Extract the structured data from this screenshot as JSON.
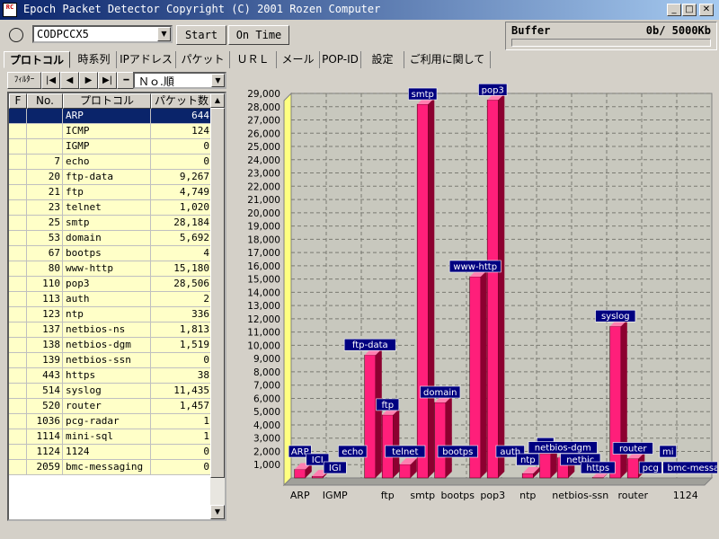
{
  "window": {
    "title": "Epoch Packet Detector   Copyright (C) 2001 Rozen Computer",
    "icon_text": "RC"
  },
  "toolbar": {
    "device": "CODPCCX5",
    "start_label": "Start",
    "ontime_label": "On Time",
    "buffer_label": "Buffer",
    "buffer_value": "0b/ 5000Kb"
  },
  "tabs": [
    "プロトコル",
    "時系列",
    "IPアドレス",
    "パケット",
    "ＵＲＬ",
    "メール",
    "POP-ID",
    "設定",
    "ご利用に関して"
  ],
  "nav": {
    "filter_label": "ﾌｨﾙﾀｰ",
    "sort_value": "Ｎｏ.順"
  },
  "table": {
    "headers": [
      "F",
      "No.",
      "プロトコル",
      "パケット数"
    ],
    "rows": [
      {
        "no": "",
        "protocol": "ARP",
        "count": "644",
        "selected": true
      },
      {
        "no": "",
        "protocol": "ICMP",
        "count": "124"
      },
      {
        "no": "",
        "protocol": "IGMP",
        "count": "0"
      },
      {
        "no": "7",
        "protocol": "echo",
        "count": "0"
      },
      {
        "no": "20",
        "protocol": "ftp-data",
        "count": "9,267"
      },
      {
        "no": "21",
        "protocol": "ftp",
        "count": "4,749"
      },
      {
        "no": "23",
        "protocol": "telnet",
        "count": "1,020"
      },
      {
        "no": "25",
        "protocol": "smtp",
        "count": "28,184"
      },
      {
        "no": "53",
        "protocol": "domain",
        "count": "5,692"
      },
      {
        "no": "67",
        "protocol": "bootps",
        "count": "4"
      },
      {
        "no": "80",
        "protocol": "www-http",
        "count": "15,180"
      },
      {
        "no": "110",
        "protocol": "pop3",
        "count": "28,506"
      },
      {
        "no": "113",
        "protocol": "auth",
        "count": "2"
      },
      {
        "no": "123",
        "protocol": "ntp",
        "count": "336"
      },
      {
        "no": "137",
        "protocol": "netbios-ns",
        "count": "1,813"
      },
      {
        "no": "138",
        "protocol": "netbios-dgm",
        "count": "1,519"
      },
      {
        "no": "139",
        "protocol": "netbios-ssn",
        "count": "0"
      },
      {
        "no": "443",
        "protocol": "https",
        "count": "38"
      },
      {
        "no": "514",
        "protocol": "syslog",
        "count": "11,435"
      },
      {
        "no": "520",
        "protocol": "router",
        "count": "1,457"
      },
      {
        "no": "1036",
        "protocol": "pcg-radar",
        "count": "1"
      },
      {
        "no": "1114",
        "protocol": "mini-sql",
        "count": "1"
      },
      {
        "no": "1124",
        "protocol": "1124",
        "count": "0"
      },
      {
        "no": "2059",
        "protocol": "bmc-messaging",
        "count": "0"
      }
    ]
  },
  "colors": {
    "bar": "#ff1f7a",
    "bar_dark": "#8c0030",
    "label_bg": "#000080",
    "plot_bg": "#c8c8be",
    "wall": "#ffff80",
    "selected_row": "#0a246a"
  },
  "chart_data": {
    "type": "bar",
    "categories": [
      "ARP",
      "ICMP",
      "IGMP",
      "echo",
      "ftp-data",
      "ftp",
      "telnet",
      "smtp",
      "domain",
      "bootps",
      "www-http",
      "pop3",
      "auth",
      "ntp",
      "netbios-ns",
      "netbios-dgm",
      "netbios-ssn",
      "https",
      "syslog",
      "router",
      "pcg-radar",
      "mini-sql",
      "1124",
      "bmc-messaging"
    ],
    "values": [
      644,
      124,
      0,
      0,
      9267,
      4749,
      1020,
      28184,
      5692,
      4,
      15180,
      28506,
      2,
      336,
      1813,
      1519,
      0,
      38,
      11435,
      1457,
      1,
      1,
      0,
      0
    ],
    "bar_labels": [
      "ARP",
      "ICI",
      "IGI",
      "echo",
      "ftp-data",
      "ftp",
      "telnet",
      "smtp",
      "domain",
      "bootps",
      "www-http",
      "pop3",
      "auth",
      "ntp",
      "ne",
      "netbios-dgm",
      "netbic",
      "https",
      "syslog",
      "router",
      "pcg",
      "mi",
      "",
      "bmc-messaging"
    ],
    "axis_labels": [
      "ARP",
      "IGMP",
      "ftp",
      "smtp",
      "bootps",
      "pop3",
      "ntp",
      "netbios-ssn",
      "router",
      "1124"
    ],
    "yticks": [
      "1,000",
      "2,000",
      "3,000",
      "4,000",
      "5,000",
      "6,000",
      "7,000",
      "8,000",
      "9,000",
      "10,000",
      "11,000",
      "12,000",
      "13,000",
      "14,000",
      "15,000",
      "16,000",
      "17,000",
      "18,000",
      "19,000",
      "20,000",
      "21,000",
      "22,000",
      "23,000",
      "24,000",
      "25,000",
      "26,000",
      "27,000",
      "28,000",
      "29,000"
    ],
    "ylim": [
      0,
      29000
    ],
    "grid": true,
    "title": "",
    "xlabel": "",
    "ylabel": ""
  }
}
